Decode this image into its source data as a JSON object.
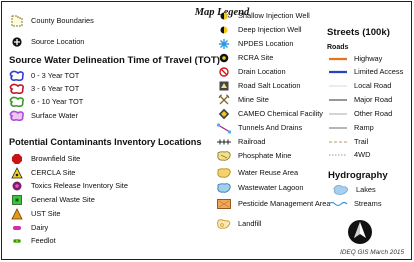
{
  "legend": {
    "title": "Map Legend",
    "col1": {
      "county_boundaries": "County Boundaries",
      "source_location": "Source Location",
      "tot_heading": "Source Water Delineation Time of Travel (TOT)",
      "tot_items": [
        "0 - 3 Year TOT",
        "3 - 6 Year TOT",
        "6 - 10 Year TOT",
        "Surface Water"
      ],
      "pci_heading": "Potential Contaminants Inventory Locations",
      "pci_items": [
        "Brownfield Site",
        "CERCLA Site",
        "Toxics Release Inventory Site",
        "General Waste Site",
        "UST Site",
        "Dairy",
        "Feedlot"
      ]
    },
    "col2": {
      "items": [
        "Shallow Injection Well",
        "Deep Injection Well",
        "NPDES Location",
        "RCRA Site",
        "Drain Location",
        "Road Salt Location",
        "Mine Site",
        "CAMEO Chemical Facility",
        "Tunnels And Drains",
        "Railroad",
        "Phosphate Mine",
        "Water Reuse Area",
        "Wastewater Lagoon",
        "Pesticide Management Area",
        "Landfill"
      ]
    },
    "col3": {
      "streets_heading": "Streets (100k)",
      "roads_subheading": "Roads",
      "roads": [
        "Highway",
        "Limited Access",
        "Local Road",
        "Major Road",
        "Other Road",
        "Ramp",
        "Trail",
        "4WD"
      ],
      "hydro_heading": "Hydrography",
      "hydro": [
        "Lakes",
        "Streams"
      ]
    },
    "footer": "IDEQ GIS March 2015",
    "colors": {
      "tot_0_3": "#2c3fd6",
      "tot_3_6": "#c0162a",
      "tot_6_10": "#3a9a2a",
      "surface_water": "#b04bd6",
      "highway": "#e8731f",
      "limited_access": "#2446b8",
      "lakes": "#a9cff0",
      "streams": "#3a92d8"
    }
  }
}
